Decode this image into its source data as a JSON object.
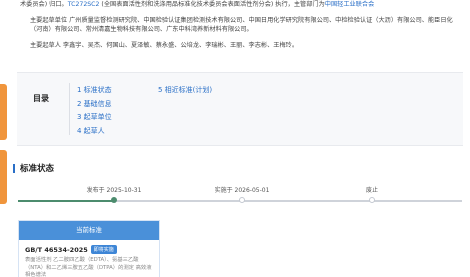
{
  "intro": {
    "line1_prefix": "术委员会) 归口。",
    "line1_code": "TC272SC2",
    "line1_suffix": " (全国表面活性剂和洗涤用品标准化技术委员会表面活性剂分会) 执行，主管部门为",
    "line1_link": "中国轻工业联合会",
    "line2": "主要起草单位 广州质量监督检测研究院、中国检验认证集团检测技术有限公司、中国日用化学研究院有限公司、中检检验认证（大沥）有限公司、能臣日化（河南）有限公司、常州清嘉生物科技有限公司、广东中科湾养新材料有限公司。",
    "line3": "主要起草人 李鑫宇、吴杰、何国山、夏泽敏、蔡永盛、公培龙、李瑞彬、王丽、李志彬、王梅玲。"
  },
  "toc": {
    "title": "目录",
    "items": [
      "1 标准状态",
      "2 基础信息",
      "3 起草单位",
      "4 起草人",
      "5 相近标准(计划)"
    ]
  },
  "status_section": {
    "title": "标准状态"
  },
  "timeline": {
    "published": "发布于 2025-10-31",
    "implemented": "实施于 2026-05-01",
    "abolished": "废止"
  },
  "current_card": {
    "header": "当前标准",
    "code": "GB/T 46534-2025",
    "badge": "即将实施",
    "description": "表面活性剂 乙二胺四乙酸（EDTA）、氨基三乙酸（NTA）和二乙烯三胺五乙酸（DTPA）的测定 高效液相色谱法"
  },
  "colors": {
    "accent": "#2a6fc7",
    "side_tab": "#f0953c",
    "timeline_done": "#4c8c6e",
    "card_header": "#4a90d9"
  }
}
